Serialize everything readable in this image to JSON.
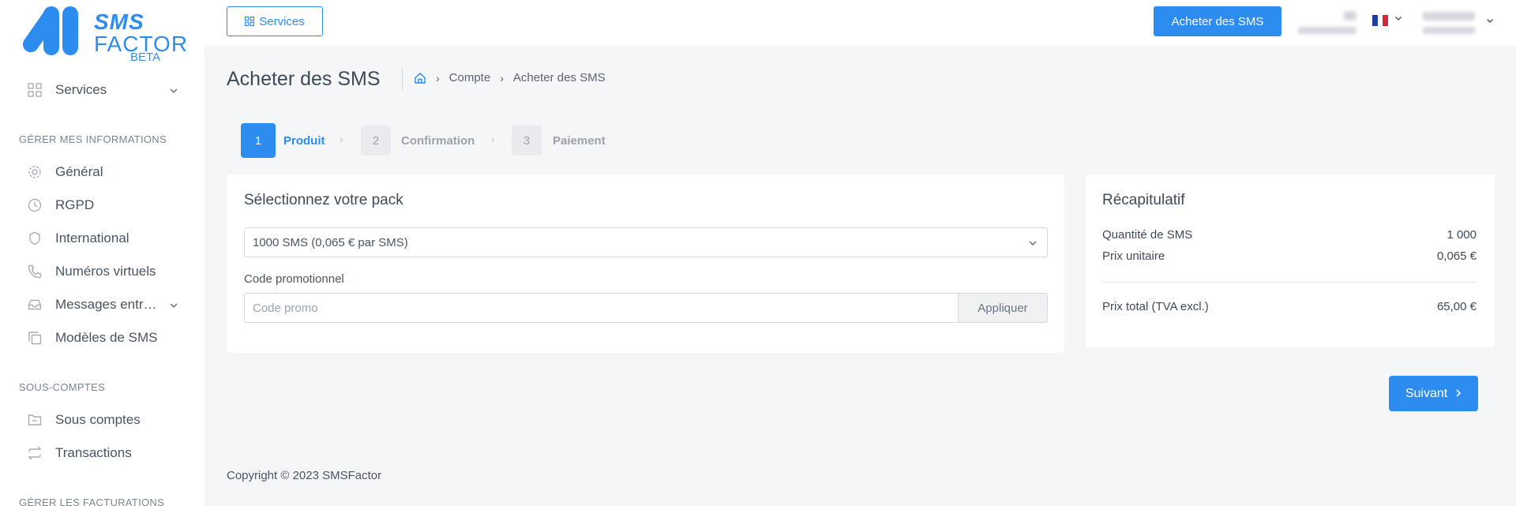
{
  "sidebar": {
    "logo": {
      "line1": "SMS",
      "line2": "FACTOR",
      "badge": "BETA"
    },
    "services_label": "Services",
    "section_manage": "GÉRER MES INFORMATIONS",
    "items_manage": [
      {
        "label": "Général",
        "icon": "gear-icon"
      },
      {
        "label": "RGPD",
        "icon": "clock-icon"
      },
      {
        "label": "International",
        "icon": "shield-icon"
      },
      {
        "label": "Numéros virtuels",
        "icon": "phone-icon"
      },
      {
        "label": "Messages entr…",
        "icon": "inbox-icon"
      },
      {
        "label": "Modèles de SMS",
        "icon": "copy-icon"
      }
    ],
    "section_subaccounts": "SOUS-COMPTES",
    "items_subaccounts": [
      {
        "label": "Sous comptes",
        "icon": "folder-icon"
      },
      {
        "label": "Transactions",
        "icon": "repeat-icon"
      }
    ],
    "section_billing": "GÉRER LES FACTURATIONS"
  },
  "header": {
    "services_button": "Services",
    "buy_button": "Acheter des SMS"
  },
  "page": {
    "title": "Acheter des SMS",
    "breadcrumb": [
      "Compte",
      "Acheter des SMS"
    ]
  },
  "steps": [
    {
      "number": "1",
      "label": "Produit",
      "active": true
    },
    {
      "number": "2",
      "label": "Confirmation",
      "active": false
    },
    {
      "number": "3",
      "label": "Paiement",
      "active": false
    }
  ],
  "pack_card": {
    "title": "Sélectionnez votre pack",
    "selected_pack": "1000 SMS (0,065 € par SMS)",
    "promo_label": "Code promotionnel",
    "promo_placeholder": "Code promo",
    "apply_button": "Appliquer"
  },
  "summary": {
    "title": "Récapitulatif",
    "quantity_label": "Quantité de SMS",
    "quantity_value": "1 000",
    "unit_price_label": "Prix unitaire",
    "unit_price_value": "0,065 €",
    "total_label": "Prix total (TVA excl.)",
    "total_value": "65,00 €"
  },
  "next_button": "Suivant",
  "footer": "Copyright © 2023 SMSFactor",
  "colors": {
    "primary": "#2d8cf0",
    "background": "#f5f6f8"
  }
}
